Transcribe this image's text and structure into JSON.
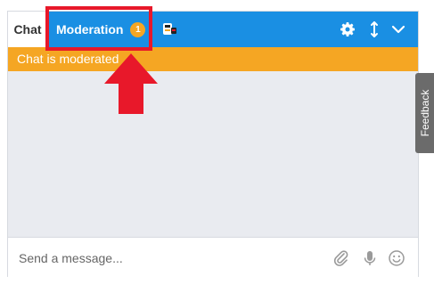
{
  "tabs": {
    "chat_label": "Chat",
    "moderation_label": "Moderation",
    "moderation_badge": "1"
  },
  "status_bar": {
    "text": "Chat is moderated"
  },
  "composer": {
    "placeholder": "Send a message..."
  },
  "feedback": {
    "label": "Feedback"
  },
  "icons": {
    "app": "app-logo-icon",
    "settings": "gear-icon",
    "popout": "popout-icon",
    "collapse": "chevron-down-icon",
    "attach": "paperclip-icon",
    "mic": "microphone-icon",
    "emoji": "smiley-icon"
  },
  "colors": {
    "header": "#1a8fe3",
    "status": "#f5a623",
    "badge": "#f5a623",
    "highlight": "#e8182a",
    "feedback_tab": "#6b6b6b"
  }
}
